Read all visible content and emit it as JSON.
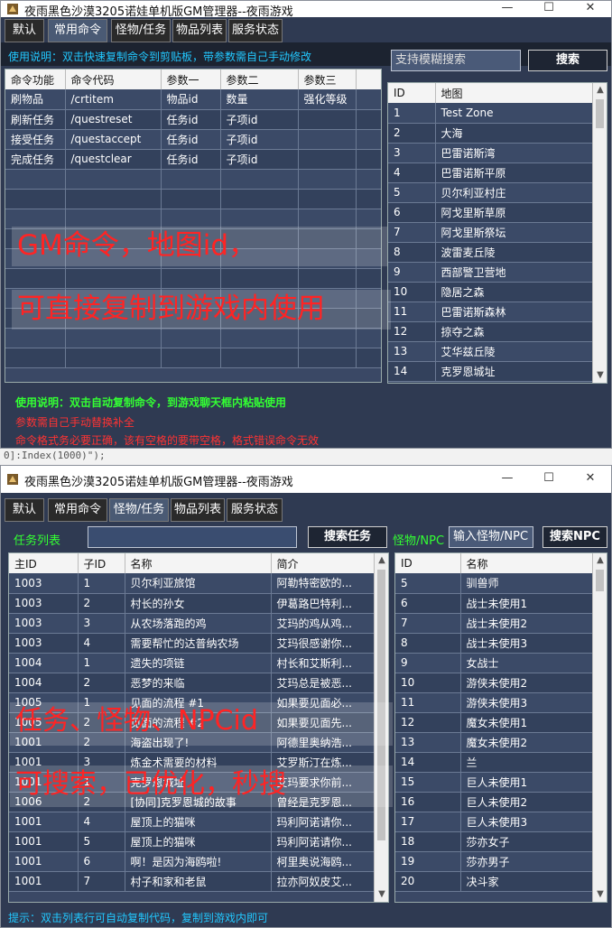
{
  "colors": {
    "notice_cyan": "#22c8ff",
    "notice_green": "#33ff33",
    "notice_red": "#ff3333",
    "overlay_red": "#ff2424",
    "panel": "#2f3a52"
  },
  "gap_text": "0]:Index(1000)\");",
  "window1": {
    "title": "夜雨黑色沙漠3205诺娃单机版GM管理器--夜雨游戏",
    "tabs": [
      "默认",
      "常用命令",
      "怪物/任务",
      "物品列表",
      "服务状态"
    ],
    "active_tab": 1,
    "usage_top": "使用说明：双击快速复制命令到剪贴板，带参数需自己手动修改",
    "search_placeholder": "支持模糊搜索",
    "search_button": "搜索",
    "command_table": {
      "columns": [
        "命令功能",
        "命令代码",
        "参数一",
        "参数二",
        "参数三"
      ],
      "rows": [
        [
          "刷物品",
          "/crtitem",
          "物品id",
          "数量",
          "强化等级"
        ],
        [
          "刷新任务",
          "/questreset",
          "任务id",
          "子项id",
          ""
        ],
        [
          "接受任务",
          "/questaccept",
          "任务id",
          "子项id",
          ""
        ],
        [
          "完成任务",
          "/questclear",
          "任务id",
          "子项id",
          ""
        ]
      ]
    },
    "map_table": {
      "columns": [
        "ID",
        "地图"
      ],
      "rows": [
        [
          "1",
          "Test Zone"
        ],
        [
          "2",
          "大海"
        ],
        [
          "3",
          "巴雷诺斯湾"
        ],
        [
          "4",
          "巴雷诺斯平原"
        ],
        [
          "5",
          "贝尔利亚村庄"
        ],
        [
          "6",
          "阿戈里斯草原"
        ],
        [
          "7",
          "阿戈里斯祭坛"
        ],
        [
          "8",
          "波雷麦丘陵"
        ],
        [
          "9",
          "西部警卫营地"
        ],
        [
          "10",
          "隐居之森"
        ],
        [
          "11",
          "巴雷诺斯森林"
        ],
        [
          "12",
          "掠夺之森"
        ],
        [
          "13",
          "艾华兹丘陵"
        ],
        [
          "14",
          "克罗恩城址"
        ]
      ]
    },
    "overlay_lines": [
      "GM命令，地图id，",
      "可直接复制到游戏内使用"
    ],
    "usage_bottom": [
      "使用说明：双击自动复制命令，到游戏聊天框内粘贴使用",
      "参数需自己手动替换补全",
      "命令格式务必要正确，该有空格的要带空格，格式错误命令无效"
    ]
  },
  "window2": {
    "title": "夜雨黑色沙漠3205诺娃单机版GM管理器--夜雨游戏",
    "tabs": [
      "默认",
      "常用命令",
      "怪物/任务",
      "物品列表",
      "服务状态"
    ],
    "active_tab": 2,
    "quest_list_label": "任务列表",
    "quest_search_button": "搜索任务",
    "npc_label": "怪物/NPC",
    "npc_input_placeholder": "输入怪物/NPC",
    "npc_search_button": "搜索NPC",
    "quest_table": {
      "columns": [
        "主ID",
        "子ID",
        "名称",
        "简介"
      ],
      "rows": [
        [
          "1003",
          "1",
          "贝尔利亚旅馆",
          "阿勒特密欧的..."
        ],
        [
          "1003",
          "2",
          "村长的孙女",
          "伊葛路巴特利..."
        ],
        [
          "1003",
          "3",
          "从农场落跑的鸡",
          "艾玛的鸡从鸡..."
        ],
        [
          "1003",
          "4",
          "需要帮忙的达普纳农场",
          "艾玛很感谢你..."
        ],
        [
          "1004",
          "1",
          "遗失的项链",
          "村长和艾斯利..."
        ],
        [
          "1004",
          "2",
          "恶梦的来临",
          "艾玛总是被恶..."
        ],
        [
          "1005",
          "1",
          "见面的流程 #1",
          "如果要见面必..."
        ],
        [
          "1005",
          "2",
          "见面的流程 #2",
          "如果要见面先..."
        ],
        [
          "1001",
          "2",
          "海盗出现了!",
          "阿德里奥纳浩..."
        ],
        [
          "1001",
          "3",
          "炼金术需要的材料",
          "艾罗斯汀在炼..."
        ],
        [
          "1001",
          "1",
          "克罗恩城址",
          "艾玛要求你前..."
        ],
        [
          "1006",
          "2",
          "[协同]克罗恩城的故事",
          "曾经是克罗恩..."
        ],
        [
          "1001",
          "4",
          "屋顶上的猫咪",
          "玛利阿诺请你..."
        ],
        [
          "1001",
          "5",
          "屋顶上的猫咪",
          "玛利阿诺请你..."
        ],
        [
          "1001",
          "6",
          "啊！是因为海鸥啦!",
          "柯里奥说海鸥..."
        ],
        [
          "1001",
          "7",
          "村子和家和老鼠",
          "拉亦阿奴皮艾..."
        ]
      ]
    },
    "npc_table": {
      "columns": [
        "ID",
        "名称"
      ],
      "rows": [
        [
          "5",
          "驯兽师"
        ],
        [
          "6",
          "战士未使用1"
        ],
        [
          "7",
          "战士未使用2"
        ],
        [
          "8",
          "战士未使用3"
        ],
        [
          "9",
          "女战士"
        ],
        [
          "10",
          "游侠未使用2"
        ],
        [
          "11",
          "游侠未使用3"
        ],
        [
          "12",
          "魔女未使用1"
        ],
        [
          "13",
          "魔女未使用2"
        ],
        [
          "14",
          "兰"
        ],
        [
          "15",
          "巨人未使用1"
        ],
        [
          "16",
          "巨人未使用2"
        ],
        [
          "17",
          "巨人未使用3"
        ],
        [
          "18",
          "莎亦女子"
        ],
        [
          "19",
          "莎亦男子"
        ],
        [
          "20",
          "决斗家"
        ]
      ]
    },
    "overlay_lines": [
      "任务、怪物、NPCid",
      "可搜索，已优化，秒搜"
    ],
    "hint": "提示：双击列表行可自动复制代码，复制到游戏内即可"
  }
}
